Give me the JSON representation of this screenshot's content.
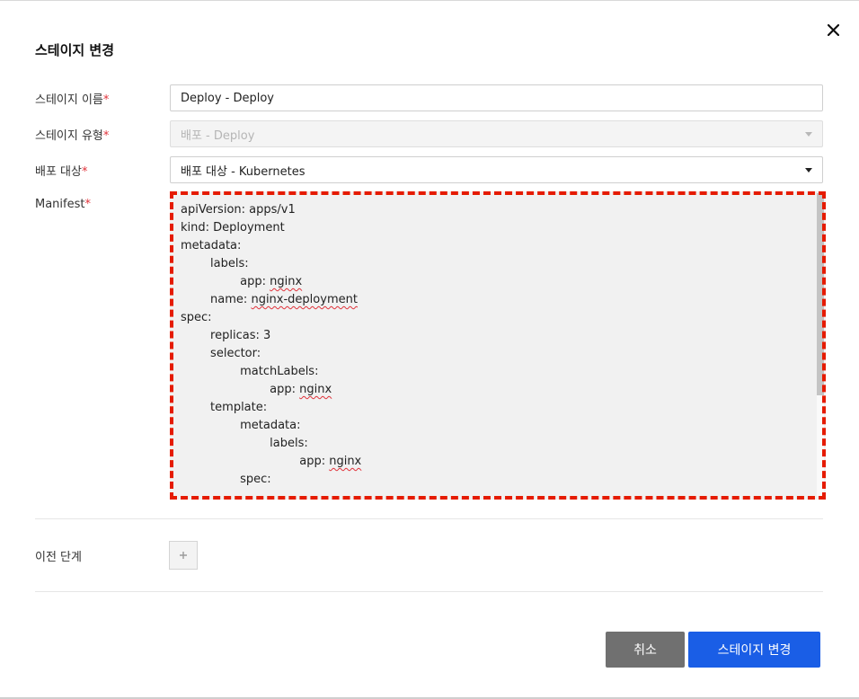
{
  "dialog": {
    "title": "스테이지 변경",
    "close_icon": "close-icon"
  },
  "form": {
    "stage_name": {
      "label": "스테이지 이름",
      "required_mark": "*",
      "value": "Deploy - Deploy"
    },
    "stage_type": {
      "label": "스테이지 유형",
      "required_mark": "*",
      "value": "배포 - Deploy",
      "disabled": true
    },
    "deploy_target": {
      "label": "배포 대상",
      "required_mark": "*",
      "value": "배포 대상 - Kubernetes"
    },
    "manifest": {
      "label": "Manifest",
      "required_mark": "*",
      "lines": [
        "apiVersion: apps/v1",
        "kind: Deployment",
        "metadata:",
        "  labels:",
        "    app: nginx",
        "  name: nginx-deployment",
        "spec:",
        "  replicas: 3",
        "  selector:",
        "    matchLabels:",
        "      app: nginx",
        "  template:",
        "    metadata:",
        "      labels:",
        "        app: nginx",
        "    spec:"
      ]
    },
    "previous_stage": {
      "label": "이전 단계",
      "add_icon": "plus-icon"
    }
  },
  "buttons": {
    "cancel": "취소",
    "confirm": "스테이지 변경"
  },
  "colors": {
    "primary": "#1a5ee6",
    "cancel": "#707070",
    "required": "#e0323a",
    "highlight_border": "#e51b00"
  }
}
